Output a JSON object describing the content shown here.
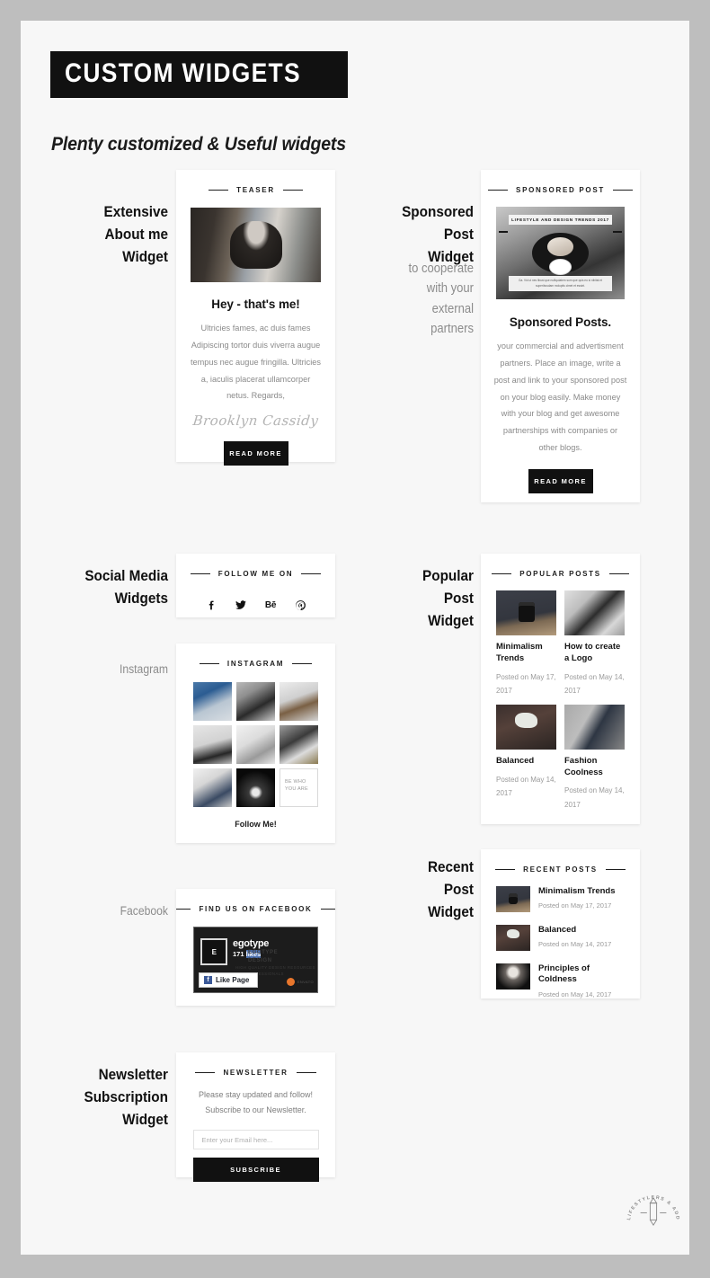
{
  "header": {
    "title": "CUSTOM WIDGETS",
    "subtitle": "Plenty customized & Useful widgets"
  },
  "colors": {
    "canvas": "#bebebe",
    "page": "#f7f7f7",
    "card": "#ffffff",
    "ink": "#111111",
    "muted": "#8a8a8a",
    "accent": "#3b5998"
  },
  "sections": {
    "about": {
      "label": "Extensive\nAbout me\nWidget",
      "line1": "Extensive",
      "line2": "About me",
      "line3": "Widget"
    },
    "sponsored": {
      "line1": "Sponsored",
      "line2": "Post",
      "line3": "Widget",
      "sub1": "to cooperate",
      "sub2": "with your",
      "sub3": "external",
      "sub4": "partners"
    },
    "social": {
      "line1": "Social Media",
      "line2": "Widgets"
    },
    "instagram": {
      "label": "Instagram"
    },
    "facebook": {
      "label": "Facebook"
    },
    "popular": {
      "line1": "Popular",
      "line2": "Post",
      "line3": "Widget"
    },
    "recent": {
      "line1": "Recent",
      "line2": "Post",
      "line3": "Widget"
    },
    "newsletter": {
      "line1": "Newsletter",
      "line2": "Subscription",
      "line3": "Widget"
    }
  },
  "about_widget": {
    "heading": "TEASER",
    "title": "Hey - that's me!",
    "body": "Ultricies fames, ac duis fames Adipiscing tortor duis viverra augue tempus nec augue fringilla. Ultricies a, iaculis placerat ullamcorper netus. Regards,",
    "signature": "Brooklyn Cassidy",
    "button": "READ MORE"
  },
  "sponsored_widget": {
    "heading": "SPONSORED POST",
    "poster_title": "LIFESTYLE AND DESIGN TRENDS 2017",
    "poster_caption": "Ga. Vid ut nes libust que nulliquiatem sum que quis eu si nihitat et superibusdam moluptis cimet et essint.",
    "title": "Sponsored Posts.",
    "body": "your commercial and advertisment partners. Place an image, write a post and link to your sponsored post on your blog easily. Make money with your blog and get awesome partnerships with companies or other blogs.",
    "button": "READ MORE"
  },
  "social_widget": {
    "heading": "FOLLOW ME ON",
    "icons": [
      {
        "name": "facebook-icon",
        "glyph": "f"
      },
      {
        "name": "twitter-icon",
        "glyph": "t"
      },
      {
        "name": "behance-icon",
        "glyph": "Bē"
      },
      {
        "name": "pinterest-icon",
        "glyph": "p"
      }
    ]
  },
  "instagram_widget": {
    "heading": "INSTAGRAM",
    "follow": "Follow Me!",
    "tile_overlay": "BE WHO\nYOU ARE",
    "tile_overlay_l1": "BE WHO",
    "tile_overlay_l2": "YOU ARE",
    "tiles": [
      "instagram-photo-building",
      "instagram-photo-dress",
      "instagram-photo-cat",
      "instagram-photo-woman",
      "instagram-photo-desk",
      "instagram-photo-shoes",
      "instagram-photo-bag",
      "instagram-photo-watch",
      "instagram-photo-quote"
    ]
  },
  "facebook_widget": {
    "heading": "FIND US ON FACEBOOK",
    "page_name": "egotype",
    "likes": "171 likes",
    "likes_count": "171",
    "likes_word": "likes",
    "avatar_initials": "E",
    "ghost_line1": "EGOTYPE",
    "ghost_line2": "DESIGN",
    "ghost_small1": "HIGH QUALITY DESIGN RESOURCES",
    "ghost_small2": "FOR PROFESSIONALS",
    "like_button": "Like Page",
    "badge_label": "ENVATO"
  },
  "popular_widget": {
    "heading": "POPULAR POSTS",
    "posts": [
      {
        "title": "Minimalism Trends",
        "date": "Posted on May 17, 2017",
        "thumb": "ph-cam"
      },
      {
        "title": "How to create a Logo",
        "date": "Posted on May 14, 2017",
        "thumb": "ph-logo"
      },
      {
        "title": "Balanced",
        "date": "Posted on May 14, 2017",
        "thumb": "ph-bal"
      },
      {
        "title": "Fashion Coolness",
        "date": "Posted on May 14, 2017",
        "thumb": "ph-fash"
      }
    ]
  },
  "recent_widget": {
    "heading": "RECENT POSTS",
    "posts": [
      {
        "title": "Minimalism Trends",
        "date": "Posted on May 17, 2017",
        "thumb": "ph-cam"
      },
      {
        "title": "Balanced",
        "date": "Posted on May 14, 2017",
        "thumb": "ph-bal"
      },
      {
        "title": "Principles of Coldness",
        "date": "Posted on May 14, 2017",
        "thumb": "ph-cold"
      }
    ]
  },
  "newsletter_widget": {
    "heading": "NEWSLETTER",
    "body": "Please stay updated and follow! Subscribe to our Newsletter.",
    "placeholder": "Enter your Email here...",
    "value": "",
    "button": "SUBSCRIBE"
  },
  "footer_logo": {
    "arc_text": "FOR LIFESTYLERS & ADDICTS",
    "icon": "pencil-icon"
  }
}
